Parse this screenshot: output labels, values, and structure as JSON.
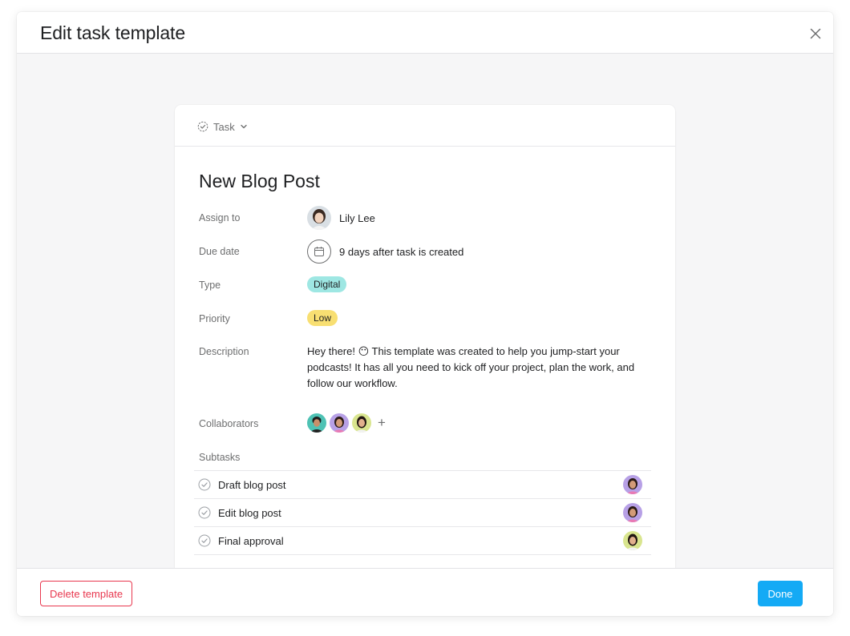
{
  "modal": {
    "title": "Edit task template",
    "close_icon": "close-icon"
  },
  "task": {
    "type_label": "Task",
    "title": "New Blog Post",
    "fields": {
      "assign_to": {
        "label": "Assign to",
        "value": "Lily Lee",
        "icon": "avatar"
      },
      "due_date": {
        "label": "Due date",
        "value": "9 days after task is created",
        "icon": "calendar-icon"
      },
      "type": {
        "label": "Type",
        "value": "Digital",
        "color": "#9ee7e3"
      },
      "priority": {
        "label": "Priority",
        "value": "Low",
        "color": "#f8df72"
      },
      "description": {
        "label": "Description",
        "value": "Hey there! 😶 This template was created to help you jump-start your podcasts! It has all you need to kick off your project, plan the work, and follow our workflow."
      },
      "collaborators": {
        "label": "Collaborators",
        "add_icon": "plus-icon"
      }
    },
    "subtasks_label": "Subtasks",
    "subtasks": [
      {
        "name": "Draft blog post"
      },
      {
        "name": "Edit blog post"
      },
      {
        "name": "Final approval"
      }
    ]
  },
  "footer": {
    "delete_label": "Delete template",
    "done_label": "Done"
  },
  "colors": {
    "accent": "#14aaf5",
    "danger": "#e8384f"
  }
}
